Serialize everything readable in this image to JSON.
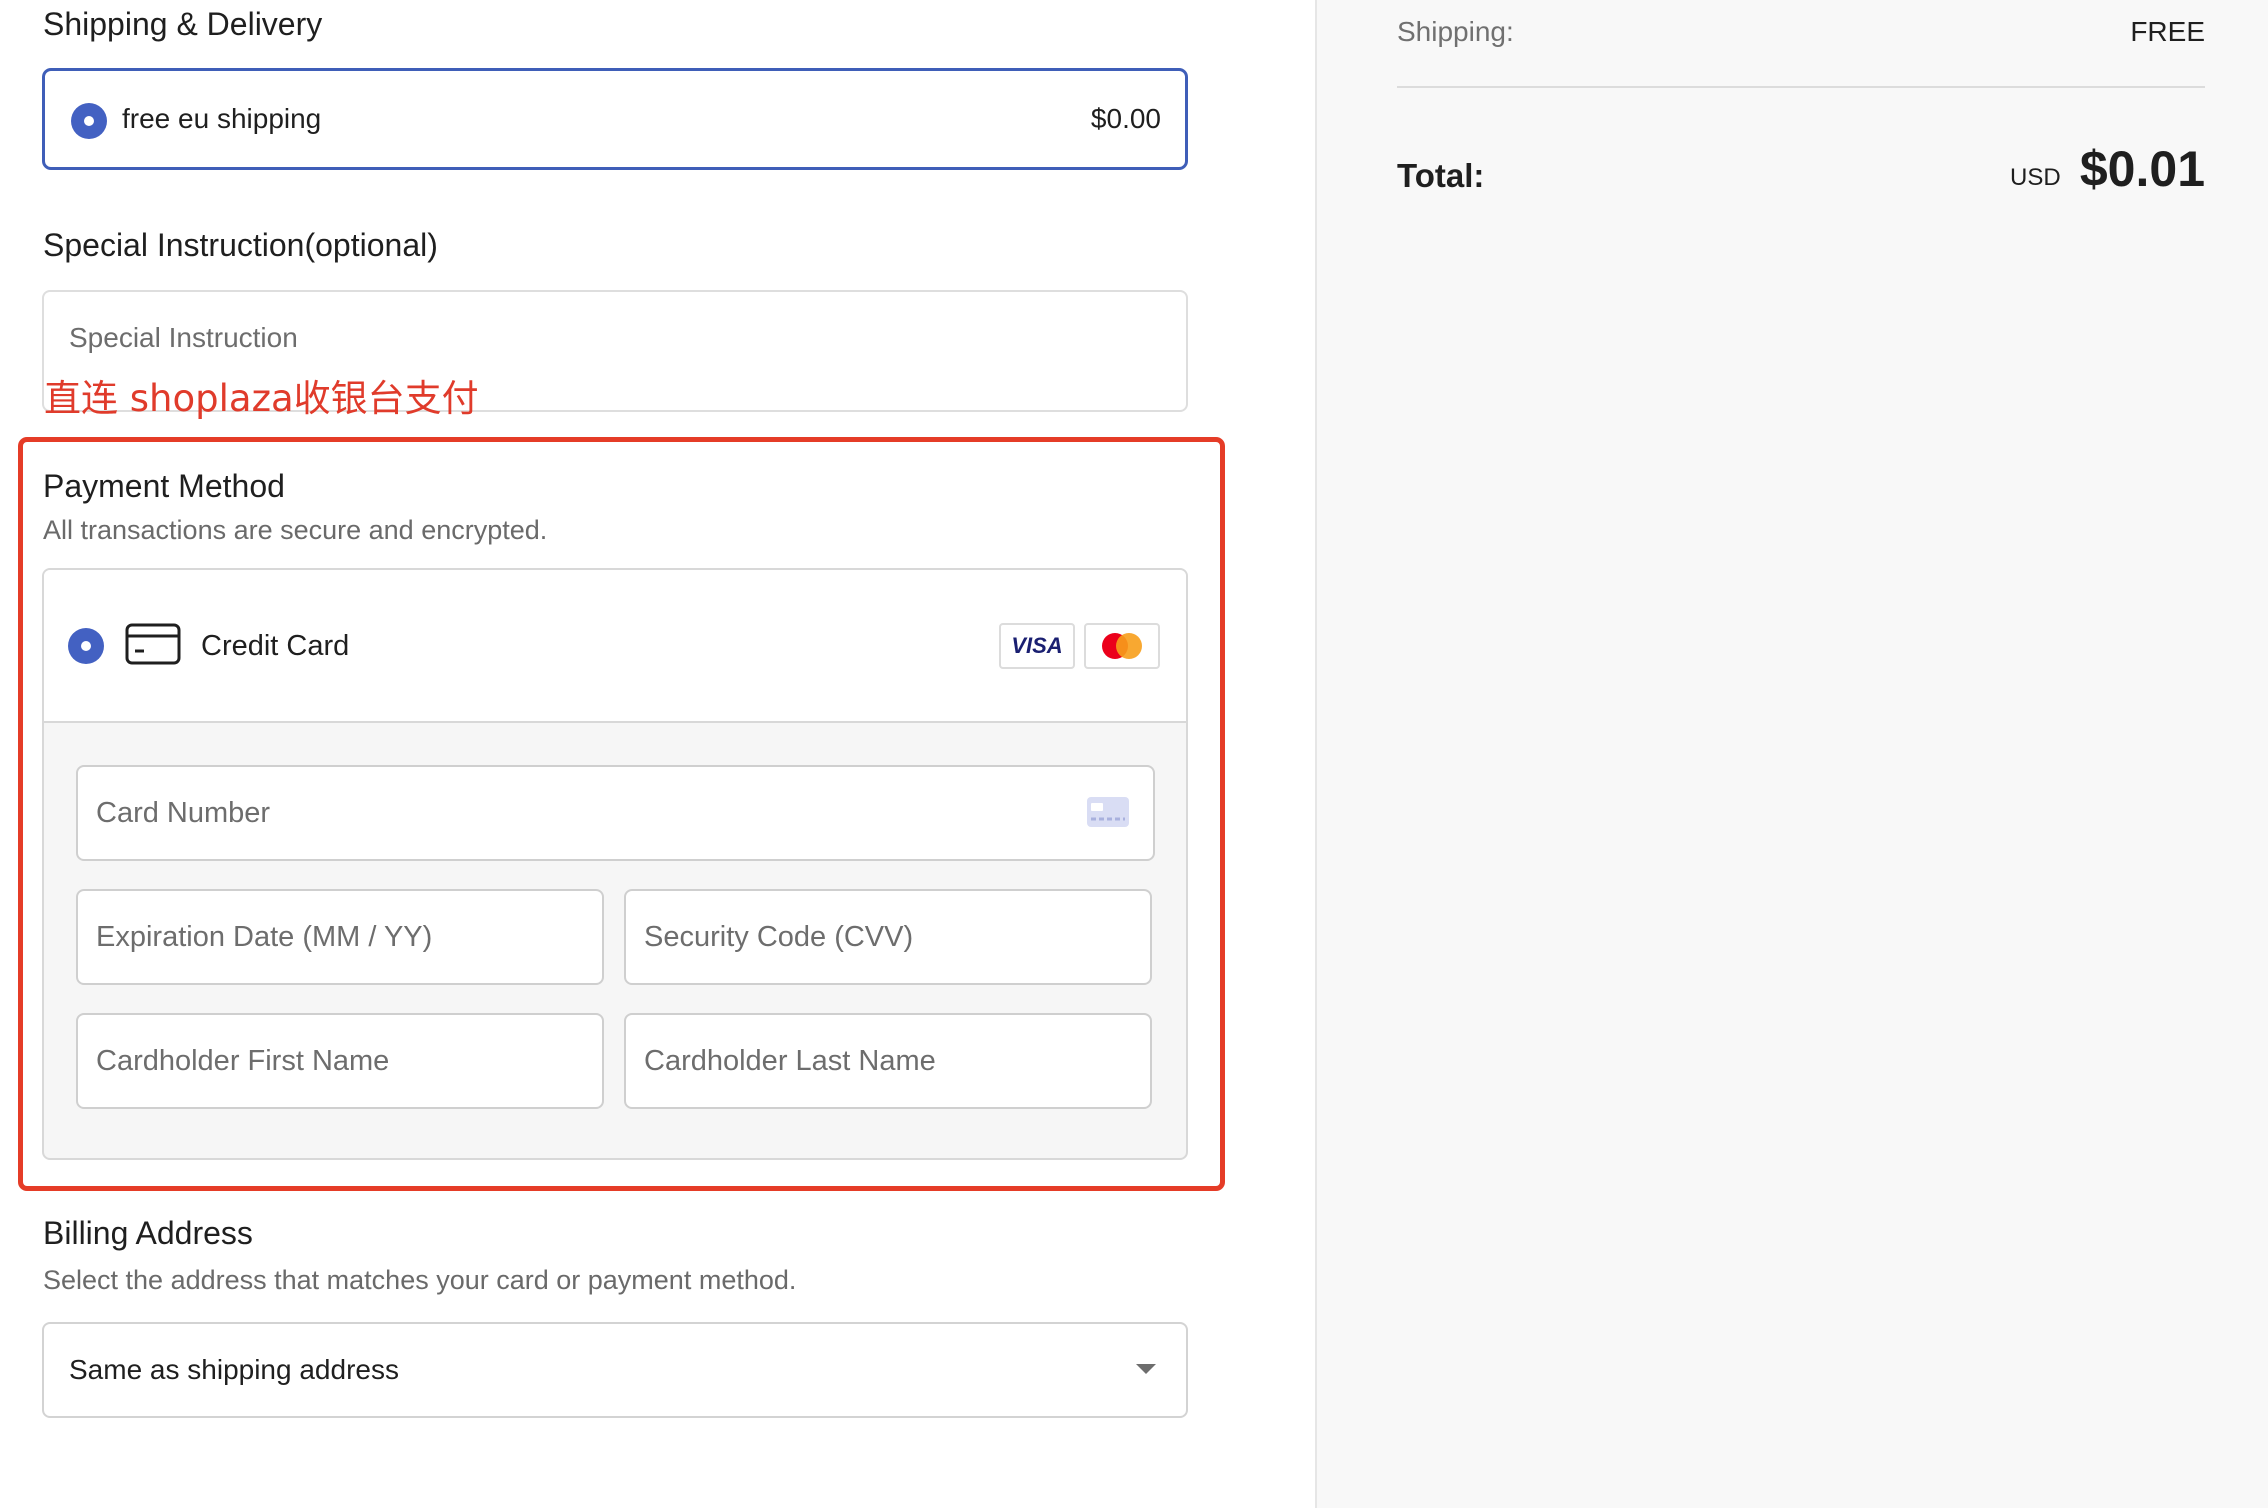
{
  "shipping": {
    "title": "Shipping & Delivery",
    "option_label": "free eu shipping",
    "option_price": "$0.00"
  },
  "instruction": {
    "title": "Special Instruction(optional)",
    "placeholder": "Special Instruction",
    "annotation": "直连 shoplaza收银台支付"
  },
  "payment": {
    "title": "Payment Method",
    "subtitle": "All transactions are secure and encrypted.",
    "method_label": "Credit Card",
    "brands": [
      "VISA",
      "mastercard"
    ],
    "fields": {
      "card_number": "Card Number",
      "expiration": "Expiration Date (MM / YY)",
      "cvv": "Security Code (CVV)",
      "first_name": "Cardholder First Name",
      "last_name": "Cardholder Last Name"
    }
  },
  "billing": {
    "title": "Billing Address",
    "subtitle": "Select the address that matches your card or payment method.",
    "selected": "Same as shipping address"
  },
  "summary": {
    "shipping_label": "Shipping:",
    "shipping_value": "FREE",
    "total_label": "Total:",
    "currency": "USD",
    "total_value": "$0.01"
  },
  "colors": {
    "accent": "#4361c2",
    "annotation_red": "#e53c27"
  }
}
